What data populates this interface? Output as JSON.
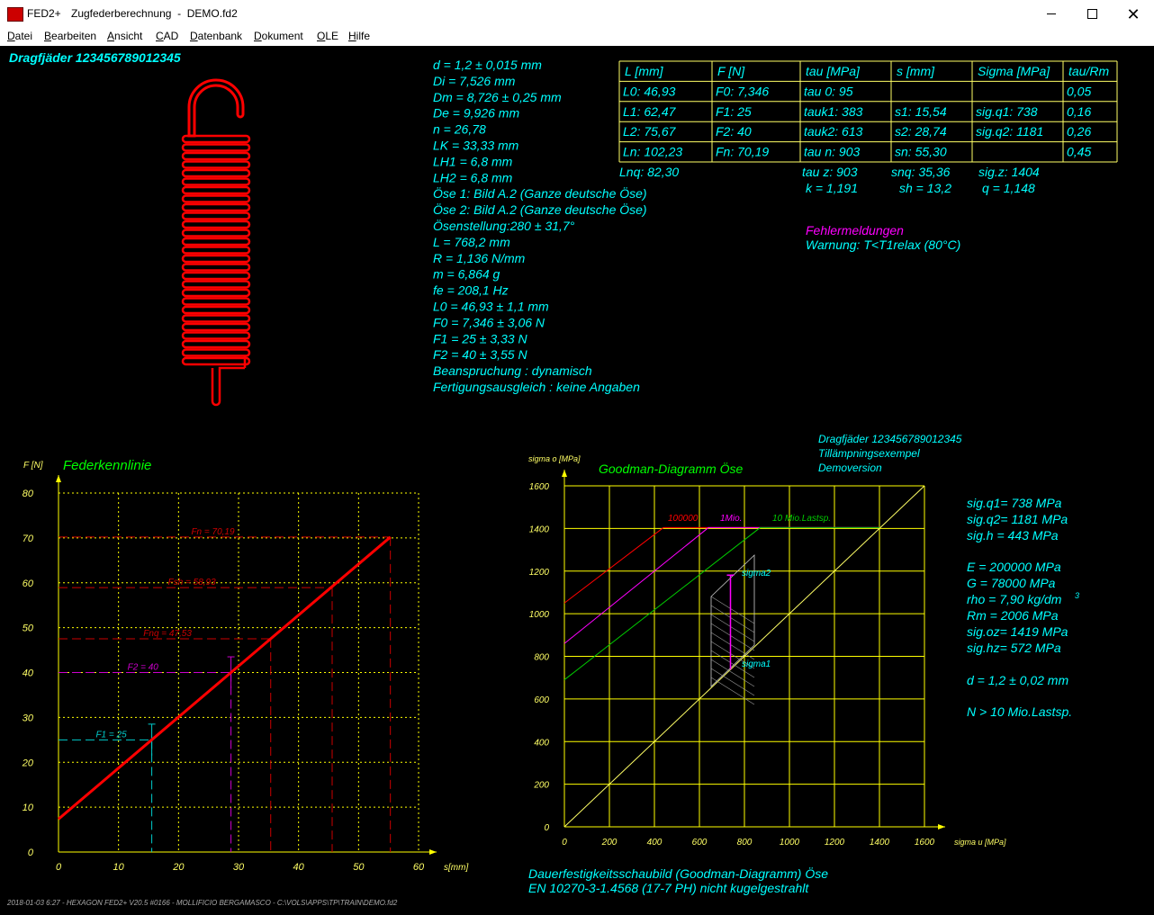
{
  "window": {
    "app_name": "FED2+",
    "title": "Zugfederberechnung  -  DEMO.fd2",
    "icon": "fed-app-icon"
  },
  "menu": [
    {
      "label": "Datei",
      "mnemonic": "D",
      "rest": "atei"
    },
    {
      "label": "Bearbeiten",
      "mnemonic": "B",
      "rest": "earbeiten"
    },
    {
      "label": "Ansicht",
      "mnemonic": "A",
      "rest": "nsicht"
    },
    {
      "label": "CAD",
      "mnemonic": "C",
      "rest": "AD"
    },
    {
      "label": "Datenbank",
      "mnemonic": "D",
      "rest": "atenbank"
    },
    {
      "label": "Dokument",
      "mnemonic": "D",
      "rest": "okument"
    },
    {
      "label": "OLE",
      "mnemonic": "O",
      "rest": "LE"
    },
    {
      "label": "Hilfe",
      "mnemonic": "H",
      "rest": "ilfe"
    }
  ],
  "header": {
    "spring_name": "Dragfjäder  123456789012345"
  },
  "params": [
    "d = 1,2 ± 0,015 mm",
    "Di = 7,526 mm",
    "Dm = 8,726 ± 0,25 mm",
    "De = 9,926 mm",
    "n = 26,78",
    "LK = 33,33 mm",
    "LH1 = 6,8 mm",
    "LH2 = 6,8 mm",
    "Öse 1: Bild A.2 (Ganze deutsche Öse)",
    "Öse 2: Bild A.2 (Ganze deutsche Öse)",
    "Ösenstellung:280 ± 31,7°",
    "L = 768,2 mm",
    "R = 1,136 N/mm",
    "m = 6,864 g",
    "fe = 208,1 Hz",
    "L0 = 46,93 ± 1,1 mm",
    "F0 = 7,346 ± 3,06 N",
    "F1 = 25 ± 3,33 N",
    "F2 = 40 ± 3,55 N",
    "Beanspruchung : dynamisch",
    "Fertigungsausgleich : keine Angaben"
  ],
  "table": {
    "headers": [
      "L [mm]",
      "F [N]",
      "tau [MPa]",
      "s [mm]",
      "Sigma [MPa]",
      "tau/Rm"
    ],
    "rows": [
      [
        "L0:  46,93",
        "F0: 7,346",
        "tau 0:   95",
        "",
        "",
        "0,05"
      ],
      [
        "L1:  62,47",
        "F1: 25",
        "tauk1:  383",
        "s1:  15,54",
        "sig.q1:  738",
        "0,16"
      ],
      [
        "L2:  75,67",
        "F2: 40",
        "tauk2:  613",
        "s2:  28,74",
        "sig.q2: 1181",
        "0,26"
      ],
      [
        "Ln: 102,23",
        "Fn: 70,19",
        "tau n:  903",
        "sn:  55,30",
        "",
        "0,45"
      ]
    ],
    "extra1": [
      "Lnq: 82,30",
      "tau z: 903",
      "snq: 35,36",
      "sig.z: 1404"
    ],
    "extra2": [
      "k = 1,191",
      "sh = 13,2",
      "q = 1,148"
    ]
  },
  "messages": {
    "title": "Fehlermeldungen",
    "warning": "Warnung: T<T1relax (80°C)"
  },
  "goodman_info": {
    "name": "Dragfjäder  123456789012345",
    "line2": "Tillämpningsexempel",
    "line3": "Demoversion"
  },
  "material": {
    "lines1": [
      "sig.q1=  738 MPa",
      "sig.q2= 1181 MPa",
      "sig.h =  443 MPa"
    ],
    "lines2": [
      "E = 200000 MPa",
      "G =  78000 MPa"
    ],
    "rho": "rho =  7,90 kg/dm",
    "rho_sup": "3",
    "lines3": [
      "Rm = 2006 MPa",
      "sig.oz= 1419 MPa",
      "sig.hz=  572 MPa"
    ],
    "d": "d  = 1,2 ± 0,02 mm",
    "n": "N > 10 Mio.Lastsp."
  },
  "footer": {
    "caption1": "Dauerfestigkeitsschaubild (Goodman-Diagramm) Öse",
    "caption2": "EN 10270-3-1.4568 (17-7 PH) nicht kugelgestrahlt",
    "status": "2018-01-03 6:27 - HEXAGON FED2+ V20.5 #0166 - MOLLIFICIO BERGAMASCO - C:\\VOLS\\APPS\\TP\\TRAIN\\DEMO.fd2"
  },
  "chart_data": [
    {
      "type": "line",
      "title": "Federkennlinie",
      "xlabel": "s[mm]",
      "ylabel": "F [N]",
      "xlim": [
        0,
        60
      ],
      "ylim": [
        0,
        80
      ],
      "xticks": [
        0,
        10,
        20,
        30,
        40,
        50,
        60
      ],
      "yticks": [
        0,
        10,
        20,
        30,
        40,
        50,
        60,
        70,
        80
      ],
      "grid": true,
      "series": [
        {
          "x": [
            0,
            55.3
          ],
          "y": [
            7.346,
            70.19
          ],
          "color": "#ff0000"
        }
      ],
      "markers": [
        {
          "label": "F1 = 25",
          "s": 15.54,
          "F": 25,
          "color": "#00cccc"
        },
        {
          "label": "F2 = 40",
          "s": 28.74,
          "F": 40,
          "color": "#cc00cc"
        },
        {
          "label": "Fnq = 47,53",
          "s": 35.36,
          "F": 47.53,
          "color": "#cc0000"
        },
        {
          "label": "Fsh = 58,93",
          "s": 45.6,
          "F": 58.93,
          "color": "#cc0000"
        },
        {
          "label": "Fn = 70,19",
          "s": 55.3,
          "F": 70.19,
          "color": "#cc0000"
        }
      ]
    },
    {
      "type": "line",
      "title": "Goodman-Diagramm Öse",
      "xlabel": "sigma u [MPa]",
      "ylabel": "sigma o [MPa]",
      "xlim": [
        0,
        1600
      ],
      "ylim": [
        0,
        1600
      ],
      "xticks": [
        0,
        200,
        400,
        600,
        800,
        1000,
        1200,
        1400,
        1600
      ],
      "yticks": [
        0,
        200,
        400,
        600,
        800,
        1000,
        1200,
        1400,
        1600
      ],
      "grid": true,
      "series": [
        {
          "name": "100000",
          "x": [
            0,
            440,
            1404
          ],
          "y": [
            1050,
            1404,
            1404
          ],
          "color": "#ff0000"
        },
        {
          "name": "1Mio.",
          "x": [
            0,
            640,
            1404
          ],
          "y": [
            860,
            1404,
            1404
          ],
          "color": "#ff00ff"
        },
        {
          "name": "10 Mio.Lastsp.",
          "x": [
            0,
            870,
            1404
          ],
          "y": [
            690,
            1404,
            1404
          ],
          "color": "#00cc00"
        },
        {
          "x": [
            0,
            1600
          ],
          "y": [
            0,
            1600
          ],
          "color": "#ffff66"
        }
      ],
      "points": [
        {
          "label": "sigma1",
          "u": 738,
          "o": 738
        },
        {
          "label": "sigma2",
          "u": 738,
          "o": 1181
        }
      ]
    }
  ]
}
